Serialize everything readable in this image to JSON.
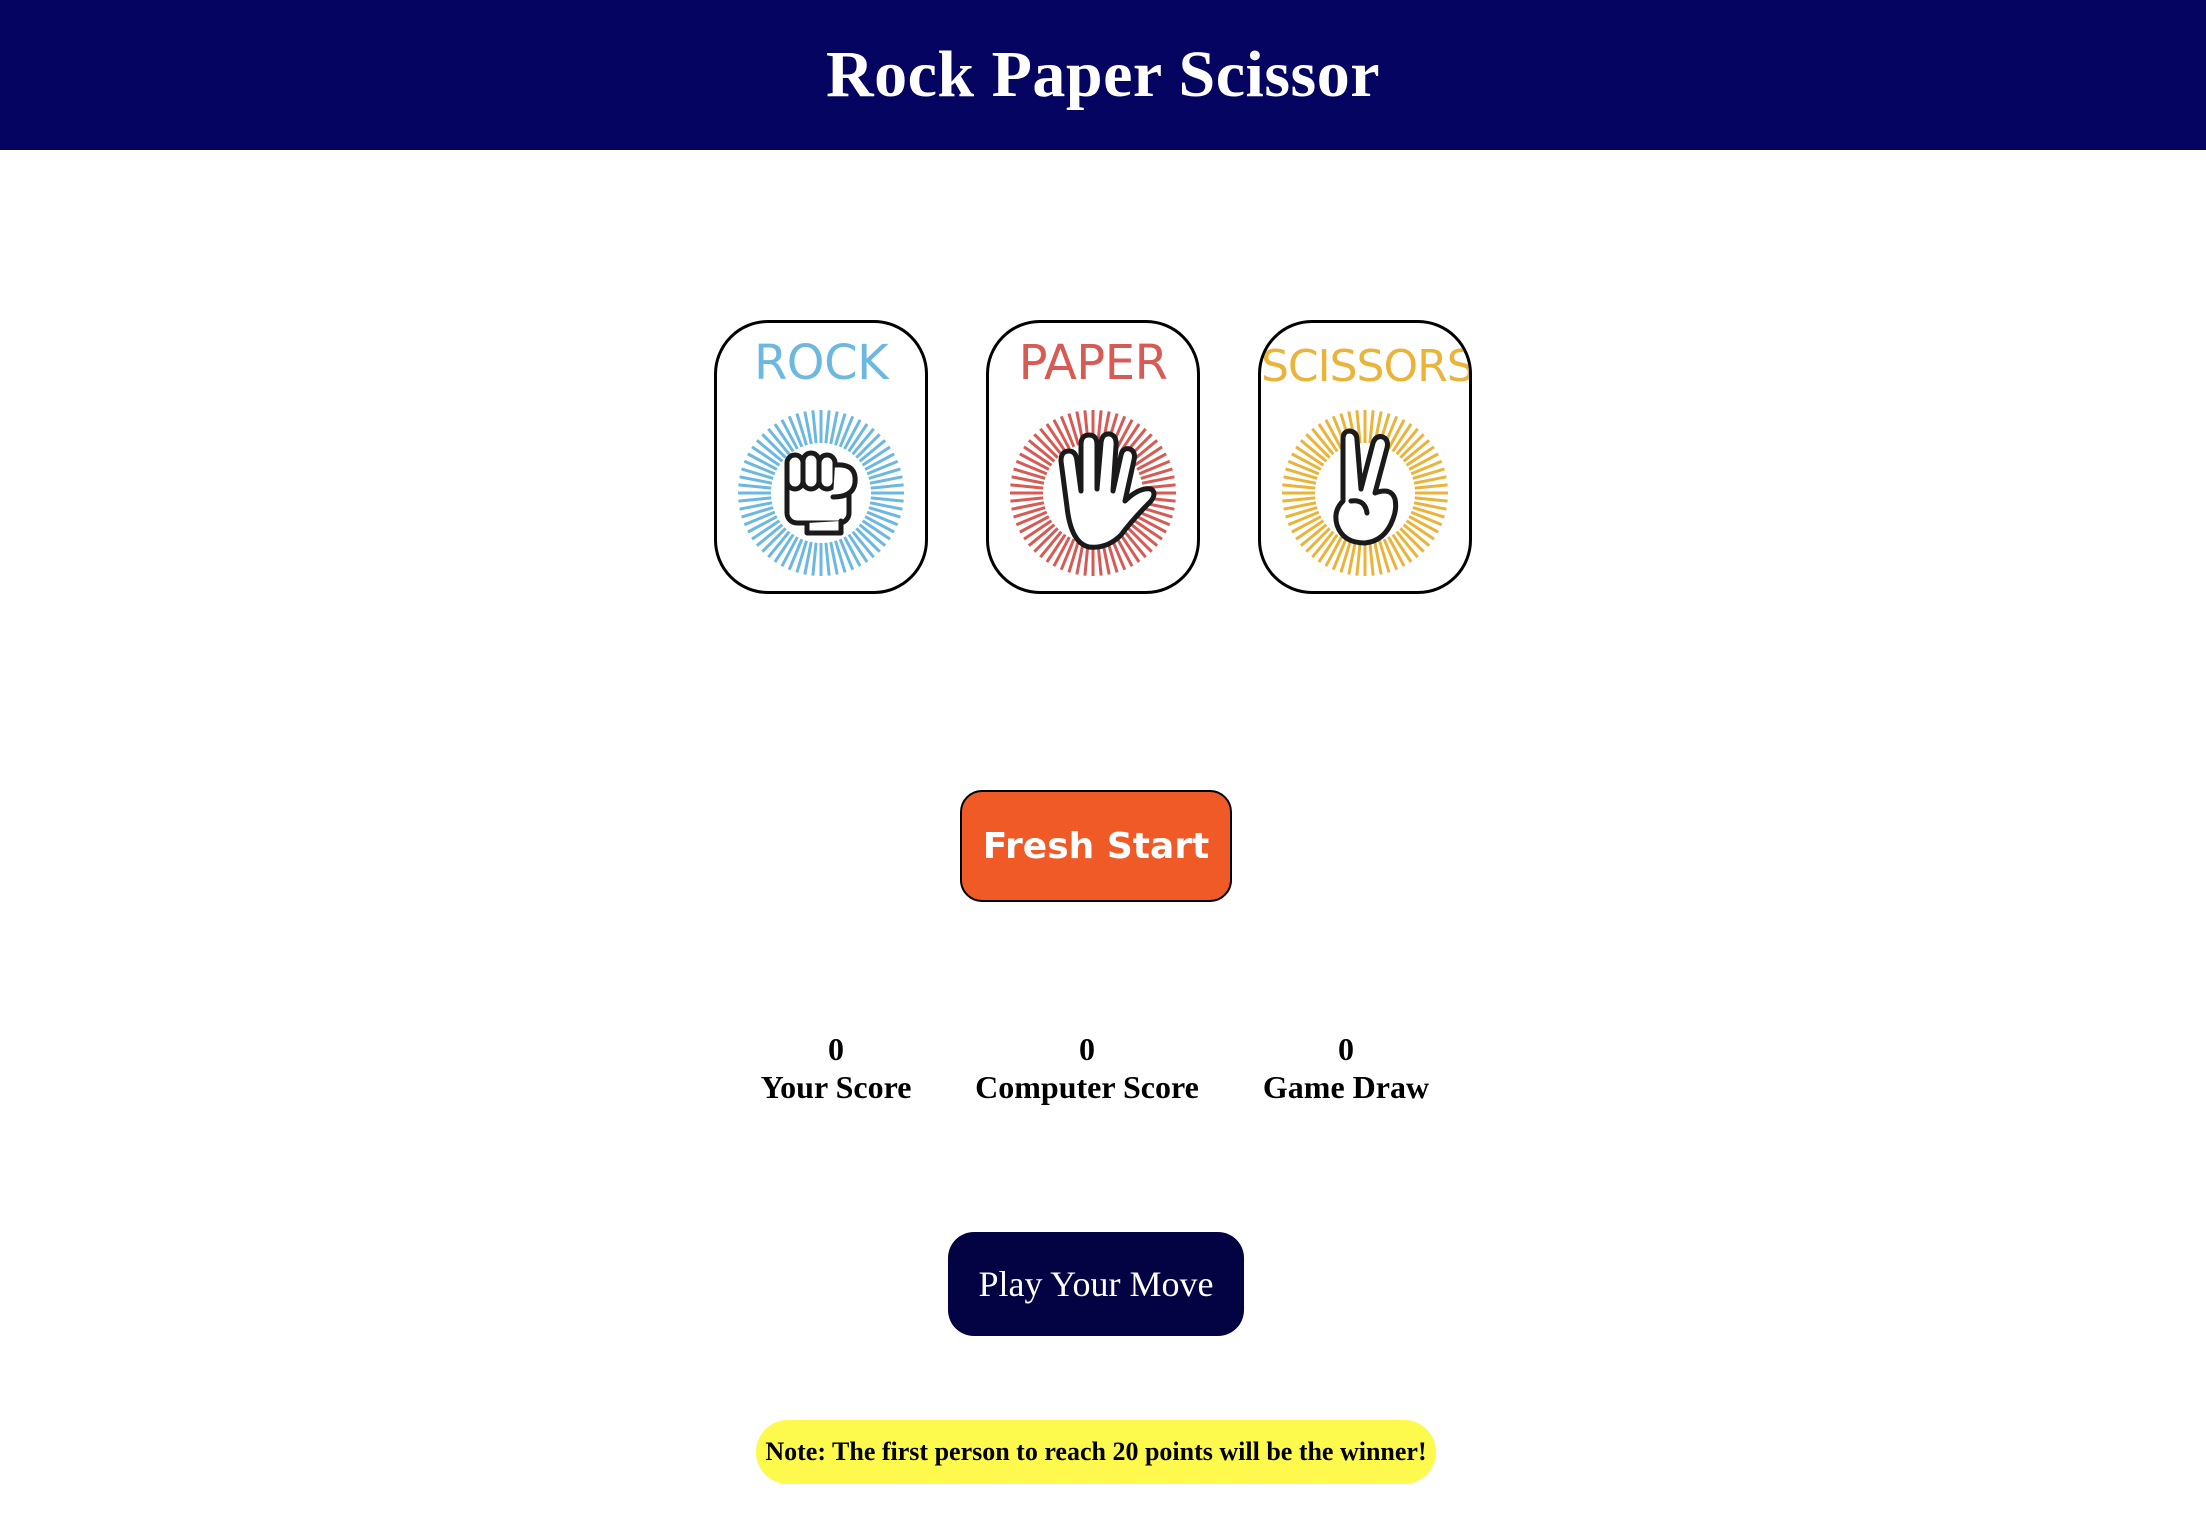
{
  "header": {
    "title": "Rock Paper Scissor"
  },
  "choices": [
    {
      "label": "ROCK",
      "icon": "fist-icon",
      "color": "#6cb8e0"
    },
    {
      "label": "PAPER",
      "icon": "open-hand-icon",
      "color": "#d65b55"
    },
    {
      "label": "SCISSORS",
      "icon": "peace-hand-icon",
      "color": "#eab43a"
    }
  ],
  "controls": {
    "fresh_start_label": "Fresh Start",
    "play_label": "Play Your Move"
  },
  "scoreboard": {
    "your_score": {
      "value": "0",
      "label": "Your Score"
    },
    "computer_score": {
      "value": "0",
      "label": "Computer Score"
    },
    "game_draw": {
      "value": "0",
      "label": "Game Draw"
    }
  },
  "note": "Note: The first person to reach 20 points will be the winner!",
  "colors": {
    "header_bg": "#050461",
    "fresh_start_bg": "#ef5a27",
    "play_bg": "#030243",
    "note_bg": "#fdf94d"
  }
}
